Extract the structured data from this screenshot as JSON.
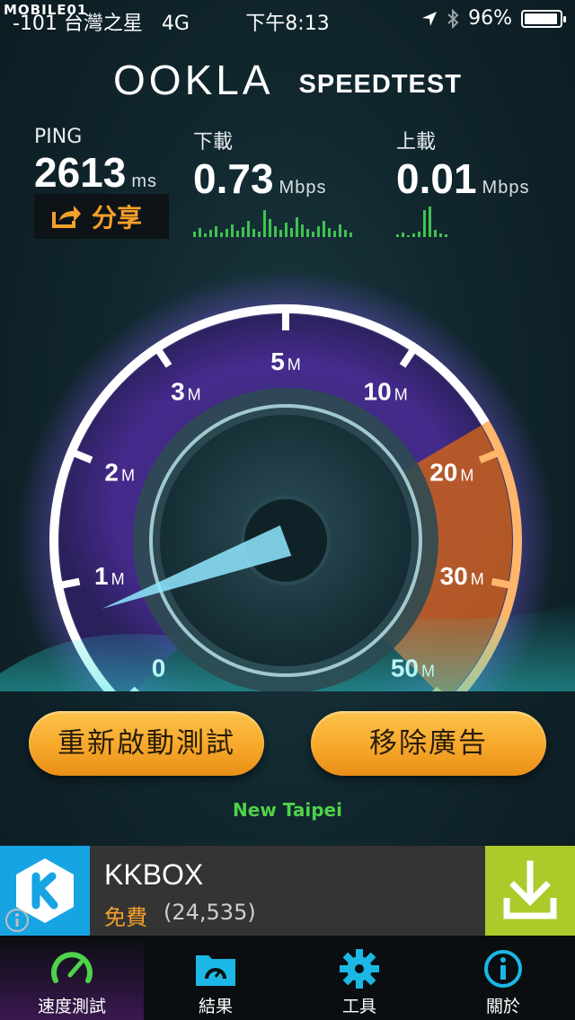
{
  "status_bar": {
    "watermark": "MOBILE01",
    "carrier": "-101 台灣之星",
    "network": "4G",
    "time": "下午8:13",
    "battery_percent": "96%",
    "battery_level": 0.96
  },
  "header": {
    "brand": "OOKLA",
    "product": "SPEEDTEST"
  },
  "metrics": {
    "ping": {
      "label": "PING",
      "value": "2613",
      "unit": "ms"
    },
    "download": {
      "label": "下載",
      "value": "0.73",
      "unit": "Mbps"
    },
    "upload": {
      "label": "上載",
      "value": "0.01",
      "unit": "Mbps"
    }
  },
  "share": {
    "label": "分享"
  },
  "gauge": {
    "ticks": [
      {
        "num": "0",
        "unit": ""
      },
      {
        "num": "1",
        "unit": "M"
      },
      {
        "num": "2",
        "unit": "M"
      },
      {
        "num": "3",
        "unit": "M"
      },
      {
        "num": "5",
        "unit": "M"
      },
      {
        "num": "10",
        "unit": "M"
      },
      {
        "num": "20",
        "unit": "M"
      },
      {
        "num": "30",
        "unit": "M"
      },
      {
        "num": "50",
        "unit": "M"
      }
    ],
    "colors": {
      "purple": "#6a3ab0",
      "orange": "#f08a1e",
      "needle": "#8fe8ff"
    }
  },
  "buttons": {
    "restart": "重新啟動測試",
    "remove_ads": "移除廣告"
  },
  "location": "New Taipei",
  "ad": {
    "app_name": "KKBOX",
    "price": "免費",
    "ratings": "(24,535)"
  },
  "tabs": [
    {
      "label": "速度測試",
      "icon": "speedometer-icon"
    },
    {
      "label": "結果",
      "icon": "folder-gauge-icon"
    },
    {
      "label": "工具",
      "icon": "gear-icon"
    },
    {
      "label": "關於",
      "icon": "info-icon"
    }
  ]
}
